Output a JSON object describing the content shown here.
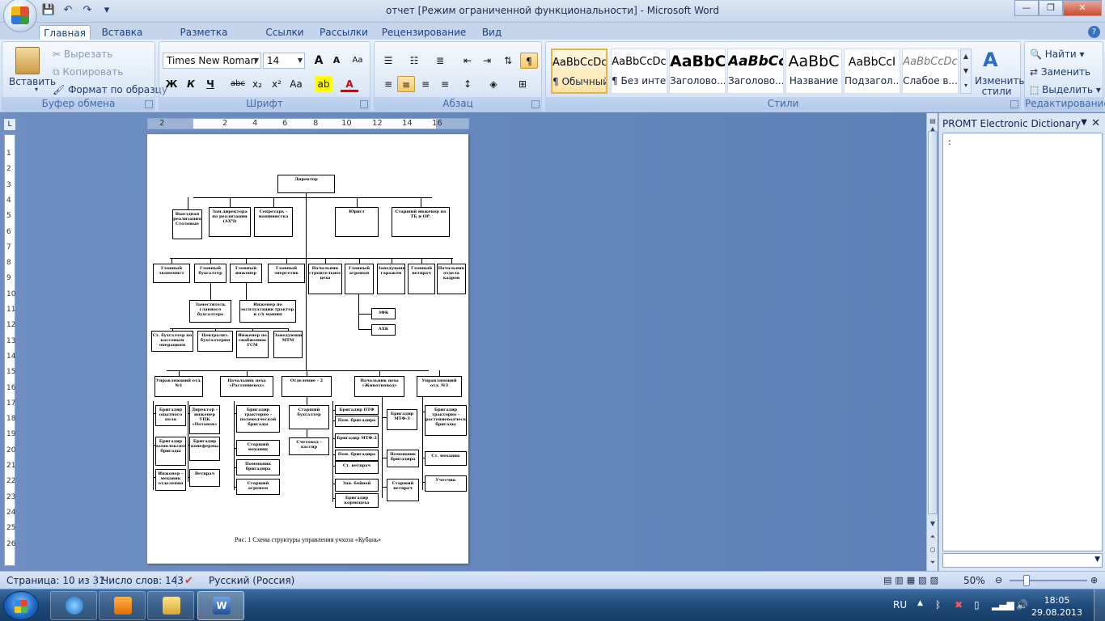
{
  "window": {
    "title": "отчет [Режим ограниченной функциональности] - Microsoft Word",
    "minimize": "—",
    "maximize": "❐",
    "close": "✕"
  },
  "qat": {
    "save": "💾",
    "undo": "↶",
    "redo": "↷",
    "more": "▾"
  },
  "tabs": [
    "Главная",
    "Вставка",
    "Разметка страницы",
    "Ссылки",
    "Рассылки",
    "Рецензирование",
    "Вид"
  ],
  "ribbon": {
    "clipboard": {
      "label": "Буфер обмена",
      "paste": "Вставить",
      "cut": "Вырезать",
      "copy": "Копировать",
      "format_painter": "Формат по образцу"
    },
    "font": {
      "label": "Шрифт",
      "family": "Times New Roman",
      "size": "14",
      "grow": "A",
      "shrink": "A",
      "clear": "Aa",
      "bold": "Ж",
      "italic": "К",
      "underline": "Ч",
      "strike": "abc",
      "subscript": "x₂",
      "superscript": "x²",
      "case": "Aa",
      "highlight": "ab",
      "color": "A"
    },
    "paragraph": {
      "label": "Абзац",
      "pilcrow": "¶"
    },
    "styles": {
      "label": "Стили",
      "change": "Изменить стили",
      "items": [
        {
          "preview": "AaBbCcDc",
          "name": "¶ Обычный"
        },
        {
          "preview": "AaBbCcDc",
          "name": "¶ Без инте..."
        },
        {
          "preview": "AaBbC",
          "name": "Заголово..."
        },
        {
          "preview": "AaBbCc",
          "name": "Заголово..."
        },
        {
          "preview": "AaBbC",
          "name": "Название"
        },
        {
          "preview": "AaBbCcI",
          "name": "Подзагол..."
        },
        {
          "preview": "AaBbCcDc",
          "name": "Слабое в..."
        }
      ]
    },
    "editing": {
      "label": "Редактирование",
      "find": "Найти",
      "replace": "Заменить",
      "select": "Выделить"
    }
  },
  "ruler": {
    "h": [
      "2",
      "2",
      "4",
      "6",
      "8",
      "10",
      "12",
      "14",
      "16"
    ],
    "v": [
      "1",
      "2",
      "3",
      "4",
      "5",
      "6",
      "7",
      "8",
      "9",
      "10",
      "11",
      "12",
      "13",
      "14",
      "15",
      "16",
      "17",
      "18",
      "19",
      "20",
      "21",
      "22",
      "23",
      "24",
      "25",
      "26"
    ]
  },
  "orgchart": {
    "director": "Директор",
    "row1": [
      "Выездная реализация Столовые",
      "Зам.директора по реализации (АХЧ)",
      "Секретарь - машинистка",
      "Юрист",
      "Старший инженер по ТБ и ОР."
    ],
    "row2": [
      "Главный экономист",
      "Главный бухгалтер",
      "Главный инженер",
      "Главный энергетик",
      "Начальник строительного цеха",
      "Главный агроном",
      "Заведующий гаражом",
      "Главный ветврач",
      "Начальник отдела кадров"
    ],
    "row3": [
      "Заместитель главного бухгалтера",
      "Инженер по эксплуатации трактор. и с/х машин",
      "ЗФК",
      "АХК"
    ],
    "row4": [
      "Ст. бухгалтер по кассовым операциям",
      "Централиз. бухгалтерия",
      "Инженер по снабжению ГСМ",
      "Заведующий МТМ"
    ],
    "row5": [
      "Управляющий отд. №1",
      "Начальник цеха «Растениевод»",
      "Отделение - 2",
      "Начальник цеха «Животновод»",
      "Управляющий отд. №3"
    ],
    "col1": [
      "Бригадир опытного поля",
      "Бригадир комплексной бригады",
      "Инженер – механик отделения"
    ],
    "col1b": [
      "Директор – инженер УПК «Потапов»",
      "Бригадир конефермы",
      "Ветврач"
    ],
    "col2": [
      "Бригадир тракторно - полеводческой бригады",
      "Старший механик",
      "Помощник бригадира",
      "Старший агроном"
    ],
    "col3": [
      "Старший бухгалтер",
      "Счетовод - кассир"
    ],
    "col4": [
      "Бригадир ПТФ",
      "Пом. бригадира",
      "Бригадир МТФ-2",
      "Пом. бригадира",
      "Ст. ветврач",
      "Зав. бойней",
      "Бригадир кормоцеха"
    ],
    "col5": [
      "Бригадир МТФ-3",
      "Помощник бригадира",
      "Старший ветврач"
    ],
    "col6": [
      "Бригадир тракторно - растениеводческой бригады",
      "Ст. механик",
      "Учетчик"
    ],
    "caption": "Рис. 1 Схема структуры управления учхоза «Кубань»"
  },
  "pane": {
    "title": "PROMT Electronic Dictionary",
    "content": ":"
  },
  "status": {
    "page": "Страница: 10 из 31",
    "words": "Число слов: 143",
    "lang": "Русский (Россия)",
    "zoom": "50%"
  },
  "taskbar": {
    "lang": "RU",
    "time": "18:05",
    "date": "29.08.2013"
  }
}
